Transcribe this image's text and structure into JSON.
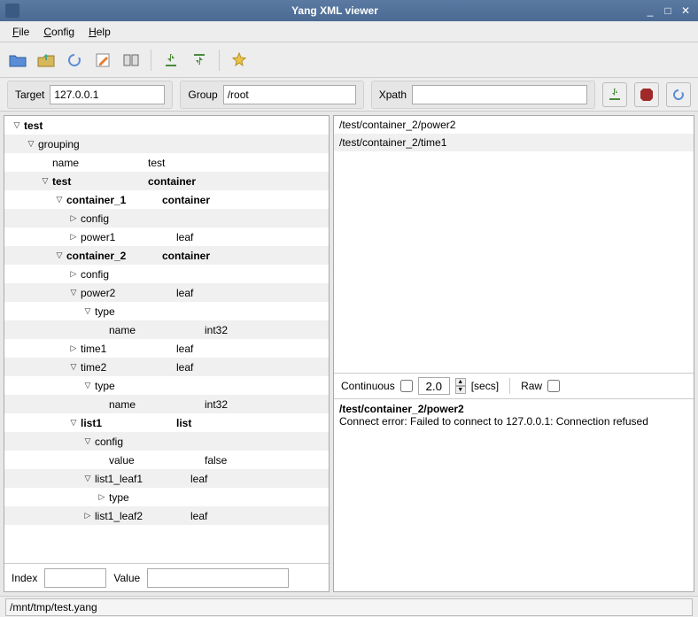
{
  "window": {
    "title": "Yang XML viewer"
  },
  "menu": {
    "file": "File",
    "config": "Config",
    "help": "Help"
  },
  "toolbar2": {
    "target_label": "Target",
    "target_value": "127.0.0.1",
    "group_label": "Group",
    "group_value": "/root",
    "xpath_label": "Xpath",
    "xpath_value": ""
  },
  "tree": {
    "rows": [
      {
        "indent": 0,
        "toggle": "▽",
        "label": "test",
        "value": "",
        "bold": true,
        "stripe": false
      },
      {
        "indent": 1,
        "toggle": "▽",
        "label": "grouping",
        "value": "",
        "bold": false,
        "stripe": true
      },
      {
        "indent": 2,
        "toggle": "",
        "label": "name",
        "value": "test",
        "bold": false,
        "stripe": false
      },
      {
        "indent": 2,
        "toggle": "▽",
        "label": "test",
        "value": "container",
        "bold": true,
        "stripe": true
      },
      {
        "indent": 3,
        "toggle": "▽",
        "label": "container_1",
        "value": "container",
        "bold": true,
        "stripe": false
      },
      {
        "indent": 4,
        "toggle": "▷",
        "label": "config",
        "value": "",
        "bold": false,
        "stripe": true
      },
      {
        "indent": 4,
        "toggle": "▷",
        "label": "power1",
        "value": "leaf",
        "bold": false,
        "stripe": false
      },
      {
        "indent": 3,
        "toggle": "▽",
        "label": "container_2",
        "value": "container",
        "bold": true,
        "stripe": true
      },
      {
        "indent": 4,
        "toggle": "▷",
        "label": "config",
        "value": "",
        "bold": false,
        "stripe": false
      },
      {
        "indent": 4,
        "toggle": "▽",
        "label": "power2",
        "value": "leaf",
        "bold": false,
        "stripe": true
      },
      {
        "indent": 5,
        "toggle": "▽",
        "label": "type",
        "value": "",
        "bold": false,
        "stripe": false
      },
      {
        "indent": 6,
        "toggle": "",
        "label": "name",
        "value": "int32",
        "bold": false,
        "stripe": true
      },
      {
        "indent": 4,
        "toggle": "▷",
        "label": "time1",
        "value": "leaf",
        "bold": false,
        "stripe": false
      },
      {
        "indent": 4,
        "toggle": "▽",
        "label": "time2",
        "value": "leaf",
        "bold": false,
        "stripe": true
      },
      {
        "indent": 5,
        "toggle": "▽",
        "label": "type",
        "value": "",
        "bold": false,
        "stripe": false
      },
      {
        "indent": 6,
        "toggle": "",
        "label": "name",
        "value": "int32",
        "bold": false,
        "stripe": true
      },
      {
        "indent": 4,
        "toggle": "▽",
        "label": "list1",
        "value": "list",
        "bold": true,
        "stripe": false
      },
      {
        "indent": 5,
        "toggle": "▽",
        "label": "config",
        "value": "",
        "bold": false,
        "stripe": true
      },
      {
        "indent": 6,
        "toggle": "",
        "label": "value",
        "value": "false",
        "bold": false,
        "stripe": false
      },
      {
        "indent": 5,
        "toggle": "▽",
        "label": "list1_leaf1",
        "value": "leaf",
        "bold": false,
        "stripe": true
      },
      {
        "indent": 6,
        "toggle": "▷",
        "label": "type",
        "value": "",
        "bold": false,
        "stripe": false
      },
      {
        "indent": 5,
        "toggle": "▷",
        "label": "list1_leaf2",
        "value": "leaf",
        "bold": false,
        "stripe": true
      }
    ]
  },
  "leftfoot": {
    "index_label": "Index",
    "index_value": "",
    "value_label": "Value",
    "value_value": ""
  },
  "xpaths": [
    {
      "text": "/test/container_2/power2",
      "stripe": false
    },
    {
      "text": "/test/container_2/time1",
      "stripe": true
    }
  ],
  "midbar": {
    "continuous_label": "Continuous",
    "interval": "2.0",
    "secs": "[secs]",
    "raw_label": "Raw"
  },
  "log": {
    "title": "/test/container_2/power2",
    "msg": "Connect error: Failed to connect to 127.0.0.1: Connection refused"
  },
  "status": {
    "path": "/mnt/tmp/test.yang"
  }
}
